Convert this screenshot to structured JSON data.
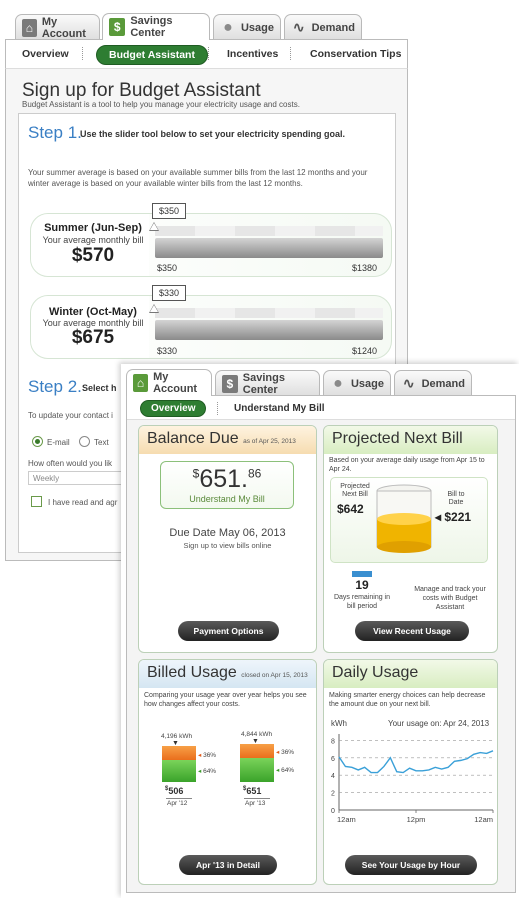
{
  "back": {
    "tabs": [
      {
        "label": "My Account",
        "icon": "home-icon"
      },
      {
        "label": "Savings Center",
        "icon": "dollar-icon"
      },
      {
        "label": "Usage",
        "icon": "lightbulb-icon"
      },
      {
        "label": "Demand",
        "icon": "wave-icon"
      }
    ],
    "subnav": {
      "overview": "Overview",
      "budget": "Budget Assistant",
      "incentives": "Incentives",
      "tips": "Conservation Tips"
    },
    "title": "Sign up for Budget Assistant",
    "subtitle": "Budget Assistant is a tool to help you manage your electricity usage and costs.",
    "step1": {
      "num": "Step 1.",
      "text": "Use the slider tool below to set your electricity spending goal."
    },
    "intro": "Your summer average is based on your available summer bills from the last 12 months and your winter average is based on your available winter bills from the last 12 months.",
    "summer": {
      "season": "Summer (Jun-Sep)",
      "caption": "Your average monthly bill",
      "amount": "$570",
      "goal": "$350",
      "min": "$350",
      "max": "$1380"
    },
    "winter": {
      "season": "Winter (Oct-May)",
      "caption": "Your average monthly bill",
      "amount": "$675",
      "goal": "$330",
      "min": "$330",
      "max": "$1240"
    },
    "step2": {
      "num": "Step 2.",
      "text": "Select h"
    },
    "contact": "To update your contact i",
    "email": "E-mail",
    "text": "Text",
    "freq_q": "How often would you lik",
    "freq": "Weekly",
    "agree": "I have read and agr"
  },
  "front": {
    "tabs": [
      {
        "label": "My Account",
        "icon": "home-icon"
      },
      {
        "label": "Savings Center",
        "icon": "dollar-icon"
      },
      {
        "label": "Usage",
        "icon": "lightbulb-icon"
      },
      {
        "label": "Demand",
        "icon": "wave-icon"
      }
    ],
    "subnav": {
      "overview": "Overview",
      "understand": "Understand My Bill"
    },
    "balance": {
      "title": "Balance Due",
      "asof": "as of Apr 25, 2013",
      "sym": "$",
      "dollars": "651.",
      "cents": "86",
      "link": "Understand My Bill",
      "due": "Due Date May 06, 2013",
      "online": "Sign up to view bills online",
      "btn": "Payment Options"
    },
    "projected": {
      "title": "Projected Next Bill",
      "desc": "Based on your average daily usage from Apr 15 to Apr 24.",
      "proj_label": "Projected Next Bill",
      "proj": "$642",
      "date_label": "Bill to Date",
      "date": "$221",
      "days": "19",
      "days_label": "Days remaining in bill period",
      "manage": "Manage and track your costs with Budget Assistant",
      "btn": "View Recent Usage"
    },
    "billed": {
      "title": "Billed Usage",
      "closed": "closed on Apr 15, 2013",
      "desc": "Comparing your usage year over year helps you see how changes affect your costs.",
      "y1": {
        "kwh": "4,196 kWh",
        "p1": "36%",
        "p2": "64%",
        "sup": "$",
        "amt": "506",
        "date": "Apr '12"
      },
      "y2": {
        "kwh": "4,844 kWh",
        "p1": "36%",
        "p2": "64%",
        "sup": "$",
        "amt": "651",
        "date": "Apr '13"
      },
      "btn": "Apr '13 in Detail"
    },
    "daily": {
      "title": "Daily Usage",
      "desc": "Making smarter energy choices can help decrease the amount due on your next bill.",
      "unit": "kWh",
      "on": "Your usage on: Apr 24, 2013",
      "yticks": [
        "8",
        "6",
        "4",
        "2",
        "0"
      ],
      "xticks": [
        "12am",
        "12pm",
        "12am"
      ],
      "btn": "See Your Usage by Hour"
    }
  },
  "chart_data": {
    "type": "line",
    "title": "Your usage on: Apr 24, 2013",
    "ylabel": "kWh",
    "ylim": [
      0,
      8.5
    ],
    "xticks": [
      "12am",
      "12pm",
      "12am"
    ],
    "x": [
      0,
      1,
      2,
      3,
      4,
      5,
      6,
      7,
      8,
      9,
      10,
      11,
      12,
      13,
      14,
      15,
      16,
      17,
      18,
      19,
      20,
      21,
      22,
      23,
      24
    ],
    "values": [
      6.1,
      5.0,
      4.9,
      4.6,
      4.9,
      4.3,
      4.3,
      5.0,
      6.0,
      4.4,
      4.3,
      4.8,
      4.5,
      4.5,
      4.6,
      4.9,
      4.7,
      4.9,
      5.6,
      5.7,
      5.9,
      6.4,
      6.6,
      6.5,
      6.8
    ]
  }
}
